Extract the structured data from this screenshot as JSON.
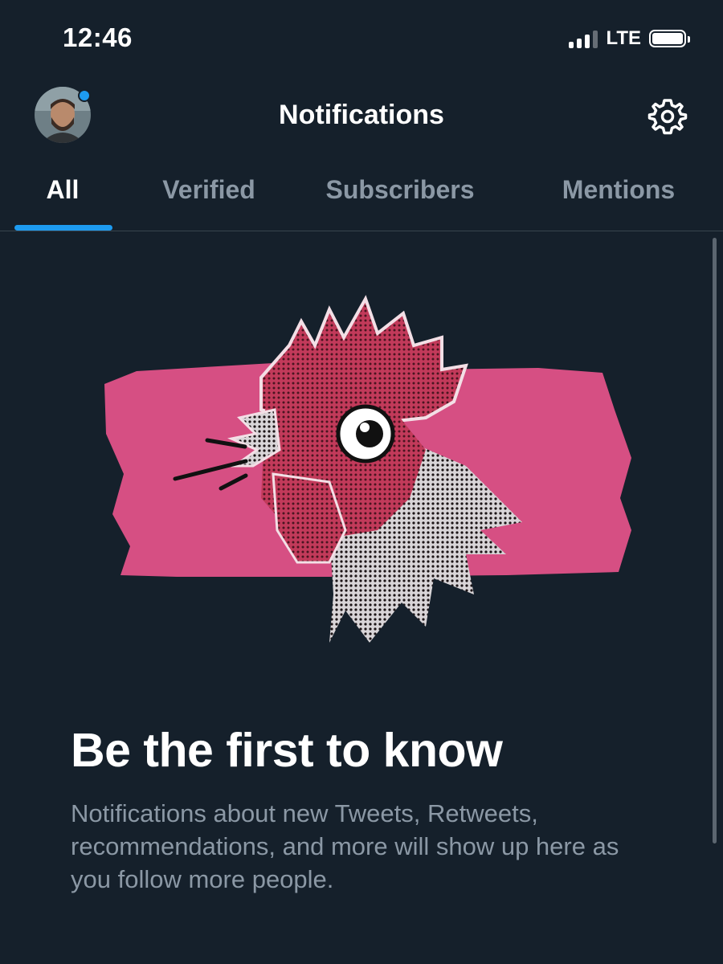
{
  "status_bar": {
    "time": "12:46",
    "network": "LTE",
    "signal_bars": 3,
    "battery_level": "high"
  },
  "header": {
    "title": "Notifications",
    "avatar_icon": "profile-avatar",
    "settings_icon": "gear-icon"
  },
  "tabs": [
    {
      "label": "All",
      "active": true
    },
    {
      "label": "Verified",
      "active": false
    },
    {
      "label": "Subscribers",
      "active": false
    },
    {
      "label": "Mentions",
      "active": false
    }
  ],
  "empty_state": {
    "illustration": "rooster-illustration",
    "title": "Be the first to know",
    "description": "Notifications about new Tweets, Retweets, recommendations, and more will show up here as you follow more people."
  },
  "colors": {
    "background": "#15202b",
    "accent": "#1d9bf0",
    "secondary_text": "#8b98a5",
    "illustration_pink": "#d64f83"
  }
}
